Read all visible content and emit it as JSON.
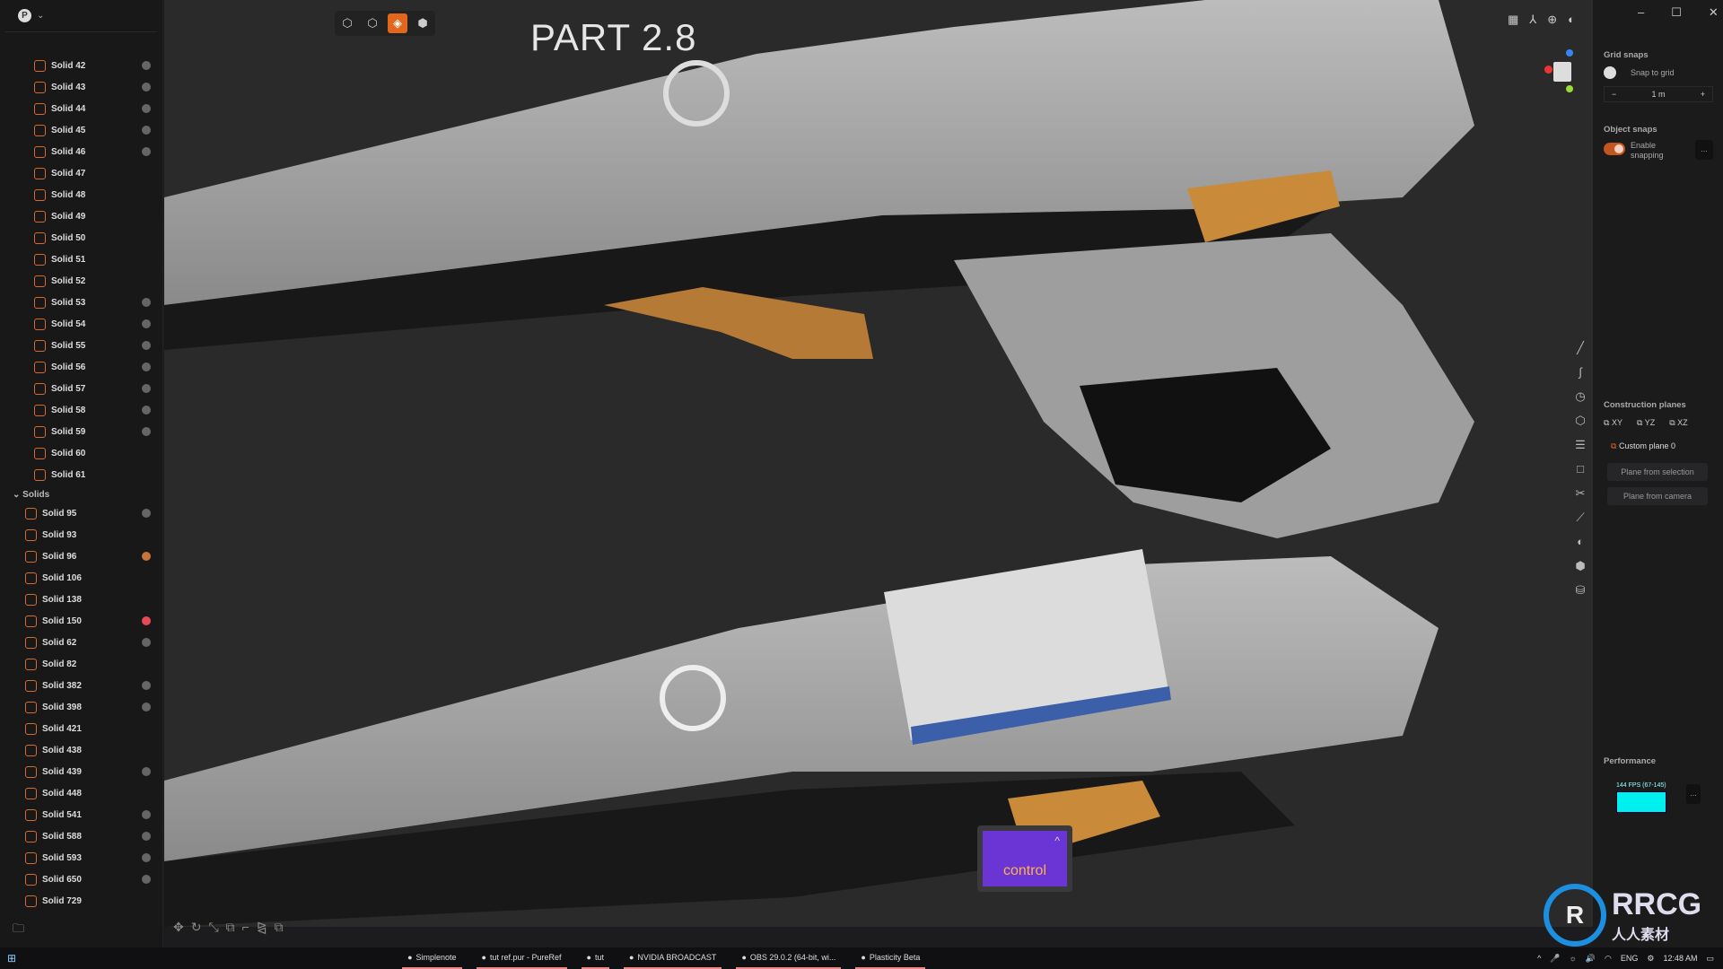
{
  "sidebar": {
    "avatar": "P",
    "items_top": [
      {
        "label": "Solid 42",
        "dot": "#666"
      },
      {
        "label": "Solid 43",
        "dot": "#666"
      },
      {
        "label": "Solid 44",
        "dot": "#666"
      },
      {
        "label": "Solid 45",
        "dot": "#666"
      },
      {
        "label": "Solid 46",
        "dot": "#666"
      },
      {
        "label": "Solid 47"
      },
      {
        "label": "Solid 48"
      },
      {
        "label": "Solid 49"
      },
      {
        "label": "Solid 50"
      },
      {
        "label": "Solid 51"
      },
      {
        "label": "Solid 52"
      },
      {
        "label": "Solid 53",
        "dot": "#666"
      },
      {
        "label": "Solid 54",
        "dot": "#666"
      },
      {
        "label": "Solid 55",
        "dot": "#666"
      },
      {
        "label": "Solid 56",
        "dot": "#666"
      },
      {
        "label": "Solid 57",
        "dot": "#666"
      },
      {
        "label": "Solid 58",
        "dot": "#666"
      },
      {
        "label": "Solid 59",
        "dot": "#666"
      },
      {
        "label": "Solid 60"
      },
      {
        "label": "Solid 61"
      }
    ],
    "group_label": "Solids",
    "items_group": [
      {
        "label": "Solid 95",
        "dot": "#666"
      },
      {
        "label": "Solid 93"
      },
      {
        "label": "Solid 96",
        "dot": "#c8743a"
      },
      {
        "label": "Solid 106"
      },
      {
        "label": "Solid 138"
      },
      {
        "label": "Solid 150",
        "dot": "#e84a55"
      },
      {
        "label": "Solid 62",
        "dot": "#666"
      },
      {
        "label": "Solid 82"
      },
      {
        "label": "Solid 382",
        "dot": "#666"
      },
      {
        "label": "Solid 398",
        "dot": "#666"
      },
      {
        "label": "Solid 421"
      },
      {
        "label": "Solid 438"
      },
      {
        "label": "Solid 439",
        "dot": "#666"
      },
      {
        "label": "Solid 448"
      },
      {
        "label": "Solid 541",
        "dot": "#666"
      },
      {
        "label": "Solid 588",
        "dot": "#666"
      },
      {
        "label": "Solid 593",
        "dot": "#666"
      },
      {
        "label": "Solid 650",
        "dot": "#666"
      },
      {
        "label": "Solid 729"
      }
    ]
  },
  "viewport": {
    "title": "PART 2.8",
    "key_overlay": "control",
    "accent": "#e3661f"
  },
  "right_panel": {
    "grid_snaps": "Grid snaps",
    "snap_to_grid": "Snap to grid",
    "grid_value": "1 m",
    "minus": "−",
    "plus": "+",
    "object_snaps": "Object snaps",
    "enable_snapping": "Enable snapping",
    "more": "...",
    "construction_planes": "Construction planes",
    "planes": [
      "XY",
      "YZ",
      "XZ"
    ],
    "custom_plane": "Custom plane 0",
    "plane_from_selection": "Plane from selection",
    "plane_from_camera": "Plane from camera",
    "performance": "Performance",
    "fps": "144 FPS (67-145)",
    "fps_color": "#00f0f0"
  },
  "taskbar": {
    "items": [
      "Simplenote",
      "tut ref.pur - PureRef",
      "tut",
      "NVIDIA BROADCAST",
      "OBS 29.0.2 (64-bit, wi...",
      "Plasticity Beta"
    ],
    "lang": "ENG",
    "time": "12:48 AM"
  },
  "watermark": {
    "text": "RRCG",
    "sub": "人人素材"
  }
}
